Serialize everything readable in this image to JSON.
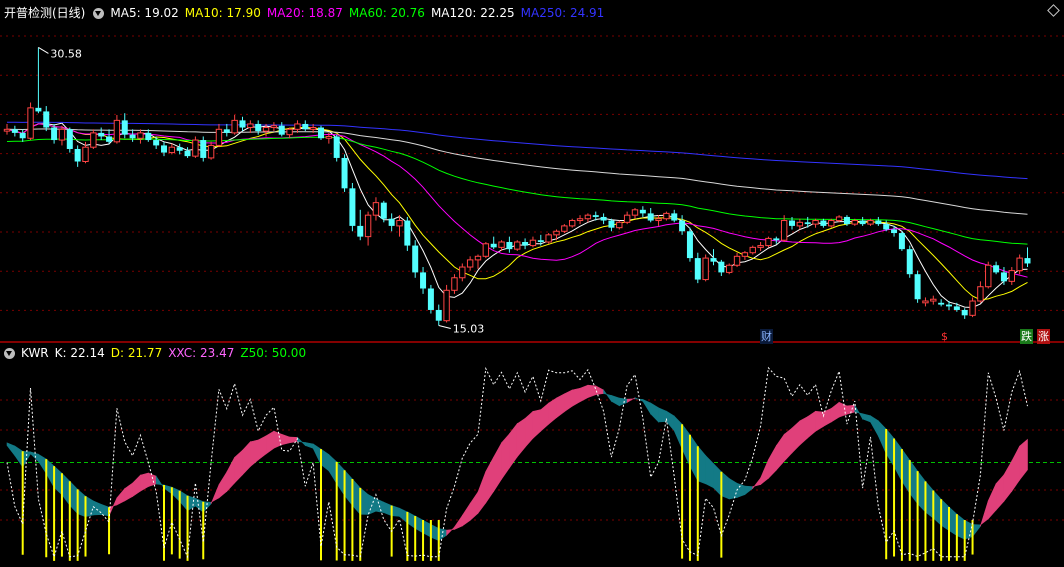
{
  "panel1": {
    "title": "开普检测(日线)",
    "indicators": [
      {
        "label": "MA5: 19.02",
        "color": "#ffffff"
      },
      {
        "label": "MA10: 17.90",
        "color": "#ffff00"
      },
      {
        "label": "MA20: 18.87",
        "color": "#ff00ff"
      },
      {
        "label": "MA60: 20.76",
        "color": "#00ff00"
      },
      {
        "label": "MA120: 22.25",
        "color": "#ffffff"
      },
      {
        "label": "MA250: 24.91",
        "color": "#3333ff"
      }
    ],
    "high_label": "30.58",
    "low_label": "15.03",
    "markers": [
      {
        "text": "财",
        "color": "#8ab4ff",
        "bg": "#0a1a3a"
      },
      {
        "text": "$",
        "color": "#ff3333",
        "bg": "#000000"
      },
      {
        "text": "跌",
        "color": "#ffffff",
        "bg": "#1a7a1a"
      },
      {
        "text": "涨",
        "color": "#ffffff",
        "bg": "#b01010"
      }
    ]
  },
  "panel2": {
    "title": "KWR",
    "indicators": [
      {
        "label": "K: 22.14",
        "color": "#ffffff"
      },
      {
        "label": "D: 21.77",
        "color": "#ffff00"
      },
      {
        "label": "XXC: 23.47",
        "color": "#ff66ff"
      },
      {
        "label": "Z50: 50.00",
        "color": "#00ff00"
      }
    ]
  },
  "colors": {
    "up": "#ff4444",
    "down": "#54ffff",
    "grid": "#8b0000",
    "ribbon_up": "#e0407a",
    "ribbon_down": "#137a86"
  },
  "chart_data": {
    "type": "candlestick",
    "price_range": [
      14.5,
      32.0
    ],
    "extremes": {
      "high": 30.58,
      "low": 15.03
    },
    "candles": [
      [
        25.9,
        26.3,
        25.7,
        26.0
      ],
      [
        26.0,
        26.2,
        25.6,
        25.8
      ],
      [
        25.8,
        26.0,
        25.3,
        25.5
      ],
      [
        25.5,
        27.5,
        25.4,
        27.2
      ],
      [
        27.2,
        30.58,
        26.9,
        27.0
      ],
      [
        27.0,
        27.3,
        25.9,
        26.1
      ],
      [
        26.1,
        26.3,
        25.2,
        25.4
      ],
      [
        25.4,
        26.2,
        25.1,
        26.0
      ],
      [
        26.0,
        26.1,
        24.7,
        24.9
      ],
      [
        24.9,
        25.1,
        23.9,
        24.2
      ],
      [
        24.2,
        25.3,
        24.1,
        25.0
      ],
      [
        25.0,
        26.0,
        24.9,
        25.8
      ],
      [
        25.8,
        26.1,
        25.4,
        25.6
      ],
      [
        25.6,
        26.0,
        25.2,
        25.3
      ],
      [
        25.3,
        26.8,
        25.2,
        26.5
      ],
      [
        26.5,
        26.9,
        25.5,
        25.7
      ],
      [
        25.7,
        26.0,
        25.3,
        25.5
      ],
      [
        25.5,
        26.0,
        25.2,
        25.8
      ],
      [
        25.8,
        26.0,
        25.3,
        25.4
      ],
      [
        25.4,
        25.6,
        24.9,
        25.1
      ],
      [
        25.1,
        25.3,
        24.5,
        24.7
      ],
      [
        24.7,
        25.2,
        24.6,
        25.0
      ],
      [
        25.0,
        25.2,
        24.6,
        24.8
      ],
      [
        24.8,
        25.0,
        24.4,
        24.5
      ],
      [
        24.5,
        25.6,
        24.4,
        25.4
      ],
      [
        25.4,
        25.6,
        24.2,
        24.4
      ],
      [
        24.4,
        25.3,
        24.3,
        25.1
      ],
      [
        25.1,
        26.3,
        25.0,
        26.0
      ],
      [
        26.0,
        26.3,
        25.6,
        25.8
      ],
      [
        25.8,
        26.8,
        25.7,
        26.5
      ],
      [
        26.5,
        26.7,
        25.9,
        26.1
      ],
      [
        26.1,
        26.5,
        25.8,
        26.3
      ],
      [
        26.3,
        26.5,
        25.7,
        25.9
      ],
      [
        25.9,
        26.3,
        25.6,
        26.1
      ],
      [
        26.1,
        26.4,
        25.9,
        26.2
      ],
      [
        26.2,
        26.4,
        25.6,
        25.7
      ],
      [
        25.7,
        26.1,
        25.5,
        26.0
      ],
      [
        26.0,
        26.5,
        25.8,
        26.3
      ],
      [
        26.3,
        26.5,
        25.9,
        26.0
      ],
      [
        26.0,
        26.3,
        25.8,
        26.1
      ],
      [
        26.1,
        26.2,
        25.4,
        25.5
      ],
      [
        25.5,
        25.8,
        25.2,
        25.6
      ],
      [
        25.6,
        25.7,
        24.2,
        24.4
      ],
      [
        24.4,
        24.6,
        22.5,
        22.7
      ],
      [
        22.7,
        23.0,
        20.3,
        20.6
      ],
      [
        20.6,
        21.5,
        19.8,
        20.0
      ],
      [
        20.0,
        21.4,
        19.5,
        21.2
      ],
      [
        21.2,
        22.2,
        20.9,
        21.9
      ],
      [
        21.9,
        22.0,
        20.8,
        21.0
      ],
      [
        21.0,
        21.3,
        20.3,
        20.6
      ],
      [
        20.6,
        21.2,
        20.0,
        20.9
      ],
      [
        20.9,
        21.1,
        19.2,
        19.5
      ],
      [
        19.5,
        19.8,
        17.7,
        18.0
      ],
      [
        18.0,
        18.3,
        16.8,
        17.1
      ],
      [
        17.1,
        17.3,
        15.7,
        15.9
      ],
      [
        15.9,
        16.2,
        15.03,
        15.3
      ],
      [
        15.3,
        17.3,
        15.2,
        17.0
      ],
      [
        17.0,
        17.9,
        16.8,
        17.7
      ],
      [
        17.7,
        18.5,
        17.5,
        18.3
      ],
      [
        18.3,
        18.9,
        18.1,
        18.7
      ],
      [
        18.7,
        19.0,
        18.2,
        18.9
      ],
      [
        18.9,
        19.7,
        18.8,
        19.6
      ],
      [
        19.6,
        20.0,
        19.3,
        19.4
      ],
      [
        19.4,
        19.8,
        19.2,
        19.7
      ],
      [
        19.7,
        20.0,
        19.1,
        19.3
      ],
      [
        19.3,
        19.8,
        19.2,
        19.7
      ],
      [
        19.7,
        19.9,
        19.3,
        19.5
      ],
      [
        19.5,
        20.0,
        19.4,
        19.8
      ],
      [
        19.8,
        20.1,
        19.5,
        19.7
      ],
      [
        19.7,
        20.2,
        19.6,
        20.1
      ],
      [
        20.1,
        20.4,
        19.8,
        20.3
      ],
      [
        20.3,
        20.7,
        20.2,
        20.6
      ],
      [
        20.6,
        21.0,
        20.5,
        20.9
      ],
      [
        20.9,
        21.2,
        20.7,
        21.0
      ],
      [
        21.0,
        21.3,
        20.8,
        21.2
      ],
      [
        21.2,
        21.4,
        20.9,
        21.1
      ],
      [
        21.1,
        21.3,
        20.7,
        20.9
      ],
      [
        20.9,
        21.0,
        20.3,
        20.5
      ],
      [
        20.5,
        20.9,
        20.4,
        20.8
      ],
      [
        20.8,
        21.4,
        20.7,
        21.2
      ],
      [
        21.2,
        21.6,
        21.0,
        21.5
      ],
      [
        21.5,
        21.7,
        21.1,
        21.3
      ],
      [
        21.3,
        21.6,
        20.8,
        20.9
      ],
      [
        20.9,
        21.2,
        20.6,
        21.0
      ],
      [
        21.0,
        21.4,
        20.9,
        21.3
      ],
      [
        21.3,
        21.5,
        20.8,
        20.9
      ],
      [
        20.9,
        21.2,
        20.1,
        20.3
      ],
      [
        20.3,
        20.5,
        18.6,
        18.8
      ],
      [
        18.8,
        19.1,
        17.4,
        17.6
      ],
      [
        17.6,
        19.0,
        17.5,
        18.8
      ],
      [
        18.8,
        19.3,
        18.4,
        18.6
      ],
      [
        18.6,
        18.7,
        17.8,
        18.0
      ],
      [
        18.0,
        18.5,
        17.9,
        18.4
      ],
      [
        18.4,
        19.1,
        18.3,
        18.9
      ],
      [
        18.9,
        19.2,
        18.7,
        19.1
      ],
      [
        19.1,
        19.5,
        19.0,
        19.4
      ],
      [
        19.4,
        19.7,
        19.2,
        19.5
      ],
      [
        19.5,
        20.0,
        19.4,
        19.9
      ],
      [
        19.9,
        20.0,
        19.6,
        19.8
      ],
      [
        19.8,
        21.2,
        19.7,
        20.9
      ],
      [
        20.9,
        21.1,
        20.4,
        20.6
      ],
      [
        20.6,
        21.0,
        20.4,
        20.8
      ],
      [
        20.8,
        21.1,
        20.5,
        20.7
      ],
      [
        20.7,
        21.0,
        20.5,
        20.9
      ],
      [
        20.9,
        21.0,
        20.5,
        20.6
      ],
      [
        20.6,
        21.0,
        20.5,
        20.9
      ],
      [
        20.9,
        21.2,
        20.8,
        21.1
      ],
      [
        21.1,
        21.2,
        20.6,
        20.7
      ],
      [
        20.7,
        21.0,
        20.6,
        20.9
      ],
      [
        20.9,
        21.1,
        20.6,
        20.7
      ],
      [
        20.7,
        21.0,
        20.6,
        20.9
      ],
      [
        20.9,
        21.1,
        20.6,
        20.7
      ],
      [
        20.7,
        20.9,
        20.3,
        20.4
      ],
      [
        20.4,
        20.6,
        20.0,
        20.2
      ],
      [
        20.2,
        20.3,
        19.2,
        19.3
      ],
      [
        19.3,
        19.5,
        17.7,
        17.9
      ],
      [
        17.9,
        18.1,
        16.3,
        16.5
      ],
      [
        16.3,
        16.6,
        16.1,
        16.4
      ],
      [
        16.4,
        16.7,
        16.2,
        16.5
      ],
      [
        16.3,
        16.5,
        16.1,
        16.2
      ],
      [
        16.2,
        16.4,
        15.9,
        16.1
      ],
      [
        16.1,
        16.3,
        15.8,
        15.9
      ],
      [
        15.9,
        16.0,
        15.4,
        15.6
      ],
      [
        15.6,
        16.6,
        15.5,
        16.4
      ],
      [
        16.4,
        17.5,
        16.3,
        17.2
      ],
      [
        17.2,
        18.6,
        17.1,
        18.4
      ],
      [
        18.4,
        18.6,
        17.9,
        18.0
      ],
      [
        18.0,
        18.3,
        17.3,
        17.5
      ],
      [
        17.5,
        18.3,
        17.3,
        18.1
      ],
      [
        18.1,
        19.0,
        17.9,
        18.8
      ],
      [
        18.8,
        19.4,
        18.3,
        18.5
      ]
    ],
    "moving_averages": [
      {
        "name": "MA5",
        "color": "#ffffff",
        "value": 19.02
      },
      {
        "name": "MA10",
        "color": "#ffff00",
        "value": 17.9
      },
      {
        "name": "MA20",
        "color": "#ff00ff",
        "value": 18.87
      },
      {
        "name": "MA60",
        "color": "#00ff00",
        "value": 20.76
      },
      {
        "name": "MA120",
        "color": "#ffffff",
        "value": 22.25
      },
      {
        "name": "MA250",
        "color": "#3333ff",
        "value": 24.91
      }
    ],
    "indicator_panel": {
      "name": "KWR",
      "range": [
        0,
        100
      ],
      "reference_line": 50,
      "K": 22.14,
      "D": 21.77,
      "XXC": 23.47,
      "Z50": 50.0
    }
  }
}
